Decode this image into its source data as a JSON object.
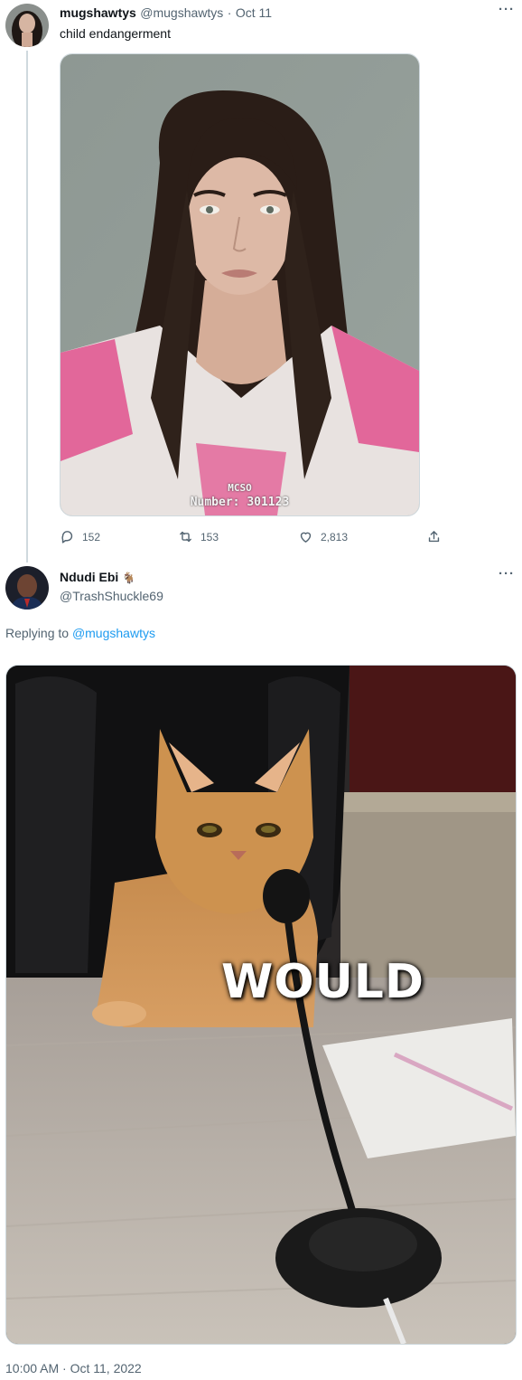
{
  "tweet1": {
    "display_name": "mugshawtys",
    "handle": "@mugshawtys",
    "separator": "·",
    "date": "Oct 11",
    "text": "child endangerment",
    "more_label": "···",
    "mugshot_caption_line1": "MCSO",
    "mugshot_caption_line2": "Number: 301123",
    "actions": {
      "replies": "152",
      "retweets": "153",
      "likes": "2,813"
    }
  },
  "tweet2": {
    "display_name": "Ndudi Ebi",
    "name_emoji": "🐐",
    "handle": "@TrashShuckle69",
    "more_label": "···",
    "replying_prefix": "Replying to",
    "replying_to": "@mugshawtys",
    "meme_caption": "WOULD",
    "timestamp": "10:00 AM · Oct 11, 2022"
  },
  "icons": [
    "reply-icon",
    "retweet-icon",
    "like-icon",
    "share-icon",
    "more-icon"
  ],
  "colors": {
    "link": "#1d9bf0",
    "muted": "#536471",
    "text": "#0f1419",
    "border": "#cfd9de"
  }
}
